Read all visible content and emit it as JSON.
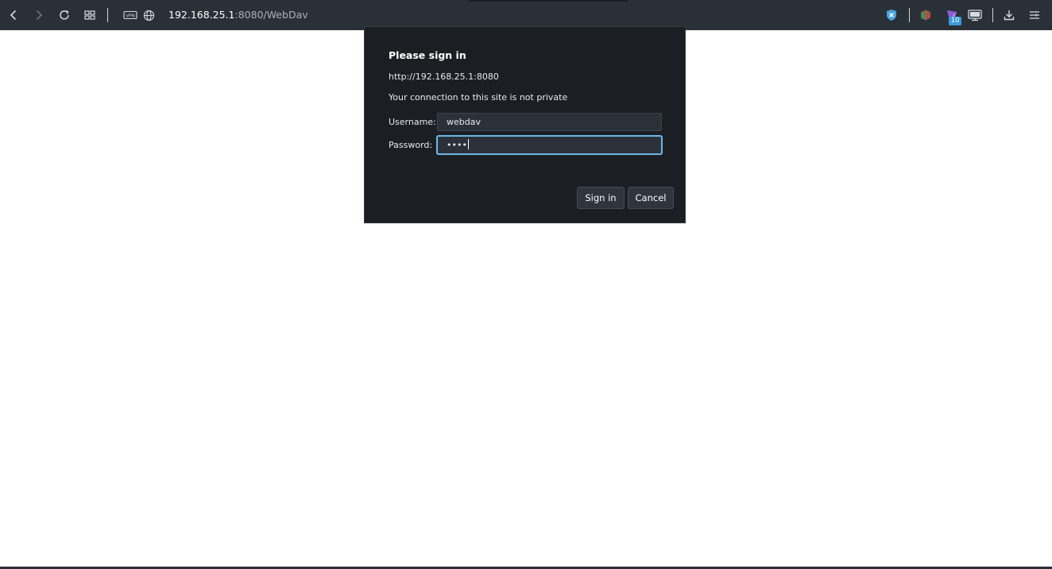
{
  "browser": {
    "url_host": "192.168.25.1",
    "url_path": ":8080/WebDav",
    "extension_badge": "10",
    "icons": {
      "back": "chevron-left-icon",
      "forward": "chevron-right-icon",
      "reload": "reload-icon",
      "tabs": "grid-icon",
      "vpn": "vpn-icon",
      "site_info": "globe-icon",
      "shield": "shield-icon",
      "ext1": "cube-icon",
      "ext2": "bird-icon",
      "ext3": "monitor-icon",
      "downloads": "download-icon",
      "menu": "menu-icon"
    },
    "colors": {
      "toolbar_bg": "#2a3038",
      "dialog_bg": "#1b1f24",
      "focus_ring": "#6fb7e8",
      "badge": "#3a9bdc"
    }
  },
  "dialog": {
    "title": "Please sign in",
    "origin": "http://192.168.25.1:8080",
    "warning": "Your connection to this site is not private",
    "username_label": "Username:",
    "username_value": "webdav",
    "password_label": "Password:",
    "password_value": "••••",
    "signin_label": "Sign in",
    "cancel_label": "Cancel"
  }
}
